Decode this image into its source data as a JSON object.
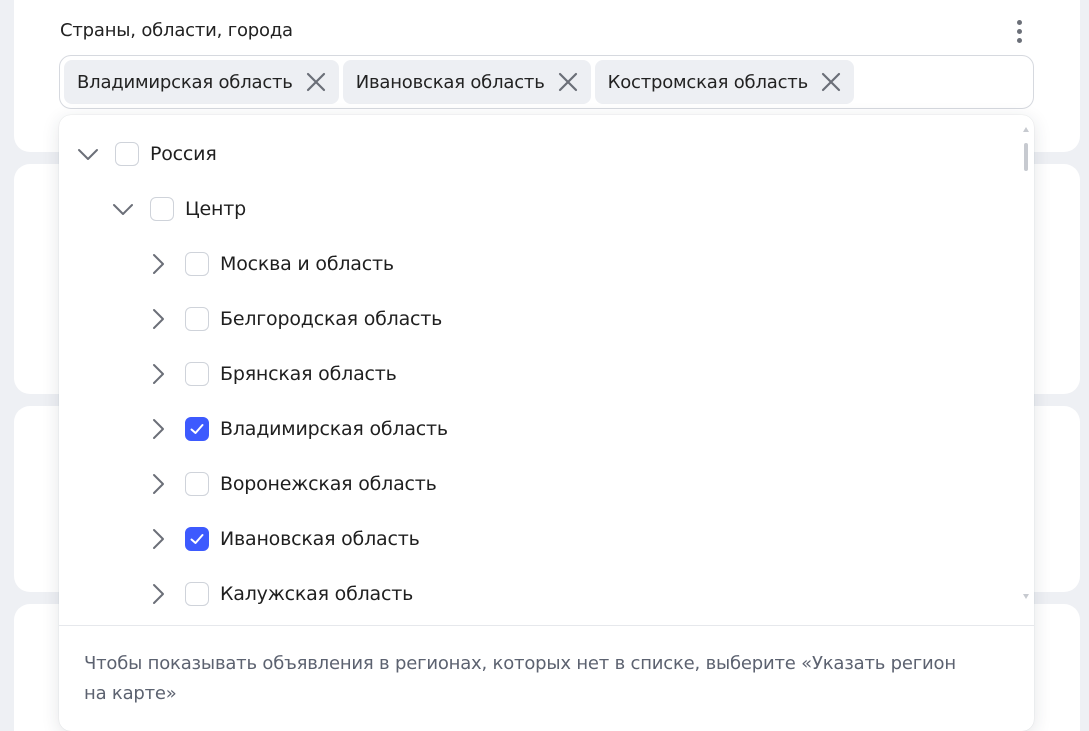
{
  "field": {
    "label": "Страны, области, города"
  },
  "chips": [
    {
      "label": "Владимирская область"
    },
    {
      "label": "Ивановская область"
    },
    {
      "label": "Костромская область"
    }
  ],
  "tree": [
    {
      "label": "Россия",
      "level": 0,
      "expanded": true,
      "checked": false
    },
    {
      "label": "Центр",
      "level": 1,
      "expanded": true,
      "checked": false
    },
    {
      "label": "Москва и область",
      "level": 2,
      "expanded": false,
      "checked": false
    },
    {
      "label": "Белгородская область",
      "level": 2,
      "expanded": false,
      "checked": false
    },
    {
      "label": "Брянская область",
      "level": 2,
      "expanded": false,
      "checked": false
    },
    {
      "label": "Владимирская область",
      "level": 2,
      "expanded": false,
      "checked": true
    },
    {
      "label": "Воронежская область",
      "level": 2,
      "expanded": false,
      "checked": false
    },
    {
      "label": "Ивановская область",
      "level": 2,
      "expanded": false,
      "checked": true
    },
    {
      "label": "Калужская область",
      "level": 2,
      "expanded": false,
      "checked": false
    }
  ],
  "hint": "Чтобы показывать объявления в регионах, которых нет в списке, выберите «Указать регион на карте»",
  "colors": {
    "accent": "#3d5afe",
    "chip_bg": "#edeff3",
    "hint_text": "#5c6270"
  },
  "icons": {
    "more": "more-vertical-icon",
    "remove": "close-icon",
    "expanded": "chevron-down-icon",
    "collapsed": "chevron-right-icon",
    "check": "check-icon"
  }
}
